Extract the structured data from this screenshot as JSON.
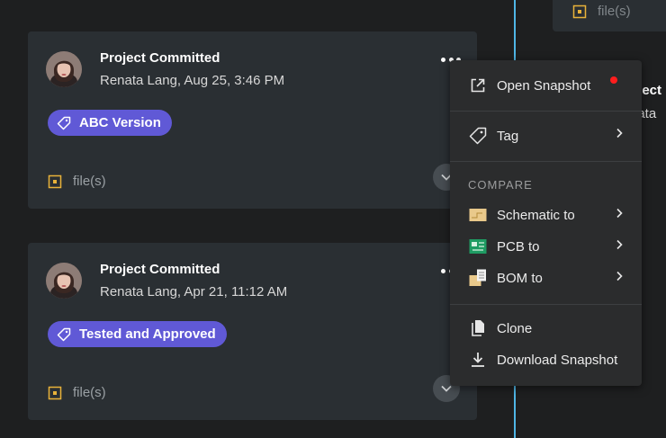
{
  "colors": {
    "accent_timeline": "#4fb6e6",
    "tag_purple": "#6059d6",
    "file_icon_yellow": "#e8b23a",
    "notification_red": "#ff1d1d"
  },
  "background_cards": {
    "top_files_label": "file(s)",
    "partial_title": "oject",
    "partial_sub": "nata"
  },
  "commits": [
    {
      "title": "Project Committed",
      "author_date": "Renata Lang, Aug 25, 3:46 PM",
      "tag": "ABC Version",
      "files_label": "file(s)"
    },
    {
      "title": "Project Committed",
      "author_date": "Renata Lang, Apr 21, 11:12 AM",
      "tag": "Tested and Approved",
      "files_label": "file(s)"
    }
  ],
  "menu": {
    "open_snapshot": "Open Snapshot",
    "tag": "Tag",
    "compare_heading": "COMPARE",
    "schematic_to": "Schematic to",
    "pcb_to": "PCB to",
    "bom_to": "BOM to",
    "clone": "Clone",
    "download_snapshot": "Download Snapshot"
  }
}
